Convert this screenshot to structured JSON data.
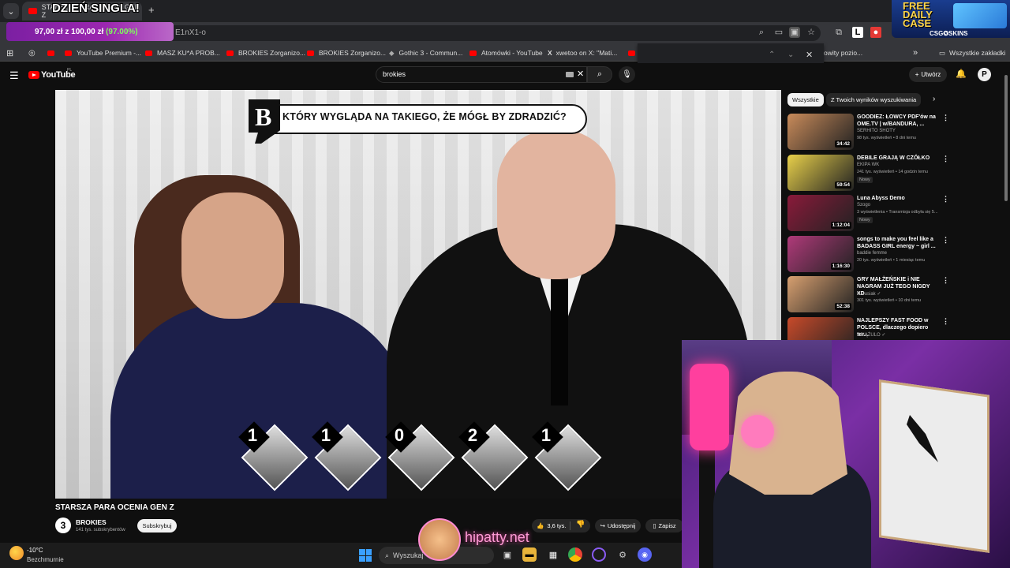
{
  "browser": {
    "tab_title": "STARSZA PARA OCENIA GEN Z",
    "tab_close": "×",
    "new_tab": "+",
    "url_fragment": "E1nX1-o",
    "bookmarks": [
      "YouTube Premium -...",
      "MASZ KU*A PROB...",
      "BROKIES Zorganizo...",
      "BROKIES Zorganizo...",
      "Gothic 3 - Commun...",
      "Atomówki - YouTube",
      "xwetoo on X: \"Mati...",
      "owity pozio..."
    ],
    "more_bookmarks": "»",
    "all_bookmarks": "Wszystkie zakładki",
    "find_up": "⌃",
    "find_down": "⌄",
    "find_close": "✕"
  },
  "overlays": {
    "promo_text": "DZIEŃ SINGLA!",
    "progress_value": "97,00 zł z 100,00 zł",
    "progress_percent": "(97.00%)",
    "csg_line1": "FREE",
    "csg_line2": "DAILY",
    "csg_line3": "CASE",
    "csg_brand": "CSG✪SKINS",
    "watermark": "hipatty.net"
  },
  "youtube": {
    "logo": "YouTube",
    "country": "PL",
    "search_value": "brokies",
    "create_label": "Utwórz",
    "avatar_letter": "P"
  },
  "video": {
    "question": "KTÓRY WYGLĄDA NA TAKIEGO, ŻE MÓGŁ BY ZDRADZIĆ?",
    "logo_letter": "B",
    "scores": [
      "1",
      "1",
      "0",
      "2",
      "1"
    ],
    "title": "STARSZA PARA OCENIA GEN Z",
    "channel": "BROKIES",
    "channel_logo": "3",
    "subscribers": "141 tys. subskrybentów",
    "subscribe": "Subskrybuj",
    "likes": "3,6 tys.",
    "share": "Udostępnij",
    "save": "Zapisz"
  },
  "sidebar": {
    "chip_all": "Wszystkie",
    "chip_yours": "Z Twoich wyników wyszukiwania",
    "recs": [
      {
        "title": "GOODIEZ: ŁOWCY PDF'ów na OME.TV | w/BANDURA, ...",
        "channel": "SERHITO SHOTY",
        "meta": "98 tys. wyświetleń • 8 dni temu",
        "duration": "34:42",
        "badge": "",
        "color": "#c98b5a"
      },
      {
        "title": "DEBILE GRAJĄ W CZÓŁKO",
        "channel": "EKIPA WK",
        "meta": "241 tys. wyświetleń • 14 godzin temu",
        "duration": "59:54",
        "badge": "Nowy",
        "color": "#e8d04a"
      },
      {
        "title": "Luna Abyss Demo",
        "channel": "Szogo",
        "meta": "3 wyświetlenia • Transmisja odbyła się 5...",
        "duration": "1:12:04",
        "badge": "Nowy",
        "color": "#8a1a3a"
      },
      {
        "title": "songs to make you feel like a BADASS GIRL energy ~ girl ...",
        "channel": "baddie femme",
        "meta": "20 tys. wyświetleń • 1 miesiąc temu",
        "duration": "1:16:30",
        "badge": "",
        "color": "#b03a7a"
      },
      {
        "title": "GRY MAŁŻEŃSKIE i NIE NAGRAM JUŻ TEGO NIGDY XD",
        "channel": "Narusiak ✓",
        "meta": "301 tys. wyświetleń • 10 dni temu",
        "duration": "52:38",
        "badge": "",
        "color": "#d8a070"
      },
      {
        "title": "NAJLEPSZY FAST FOOD w POLSCE, dlaczego dopiero ter...",
        "channel": "KSIĄŻULO ✓",
        "meta": "",
        "duration": "",
        "badge": "",
        "color": "#c84a2a"
      }
    ]
  },
  "taskbar": {
    "temp": "-10°C",
    "condition": "Bezchmurnie",
    "search_placeholder": "Wyszukaj"
  }
}
